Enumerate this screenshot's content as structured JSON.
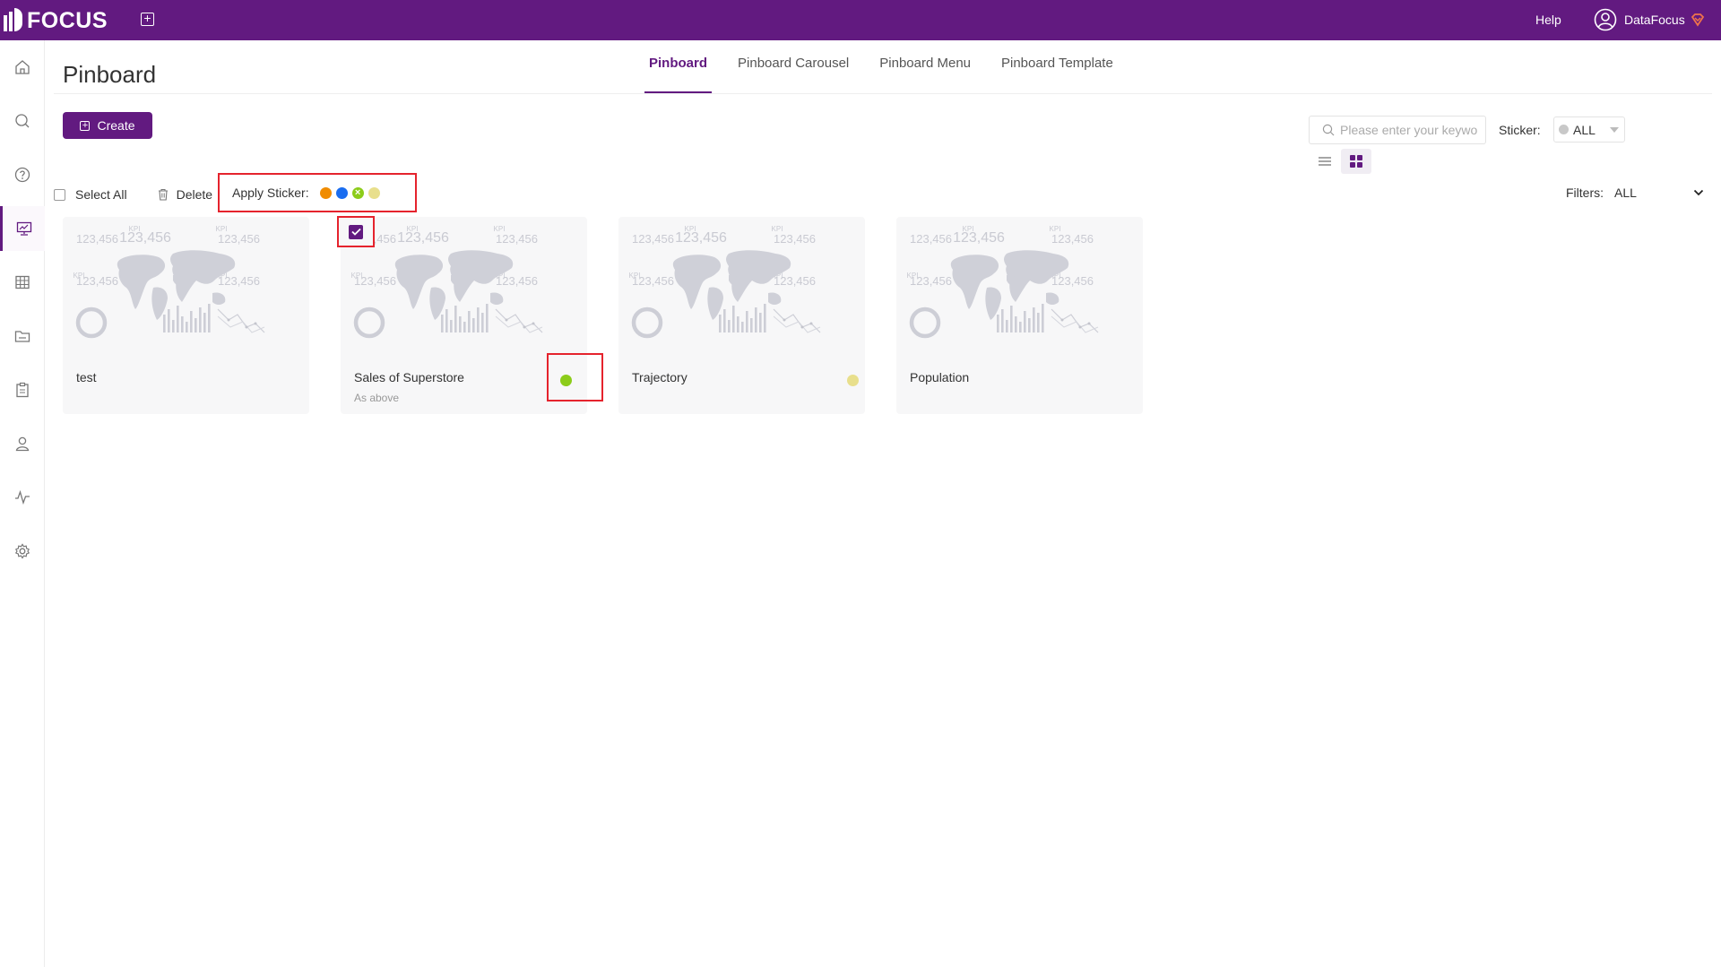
{
  "app": {
    "logo_text": "FOCUS"
  },
  "topbar": {
    "help": "Help",
    "user_name": "DataFocus"
  },
  "sidebar": {
    "items": [
      {
        "icon": "home-icon"
      },
      {
        "icon": "search-icon"
      },
      {
        "icon": "question-icon"
      },
      {
        "icon": "pinboard-icon",
        "active": true
      },
      {
        "icon": "table-icon"
      },
      {
        "icon": "folder-icon"
      },
      {
        "icon": "clipboard-icon"
      },
      {
        "icon": "user-icon"
      },
      {
        "icon": "pulse-icon"
      },
      {
        "icon": "gear-icon"
      }
    ]
  },
  "page": {
    "title": "Pinboard"
  },
  "tabs": [
    {
      "label": "Pinboard",
      "active": true
    },
    {
      "label": "Pinboard Carousel",
      "active": false
    },
    {
      "label": "Pinboard Menu",
      "active": false
    },
    {
      "label": "Pinboard Template",
      "active": false
    }
  ],
  "create_button": "Create",
  "search": {
    "placeholder": "Please enter your keywo",
    "value": ""
  },
  "sticker_filter": {
    "label": "Sticker:",
    "value": "ALL"
  },
  "toolbar": {
    "select_all": "Select All",
    "delete": "Delete",
    "apply_sticker": "Apply Sticker:",
    "sticker_colors": [
      "#f08c00",
      "#1a6df0",
      "#8ccc1a",
      "#e8df8c"
    ]
  },
  "filters": {
    "label": "Filters:",
    "value": "ALL"
  },
  "thumbnail": {
    "kpi_value": "123,456",
    "kpi_label": "KPI"
  },
  "cards": [
    {
      "name": "test",
      "subtitle": "",
      "sticker": null,
      "checked": false
    },
    {
      "name": "Sales of Superstore",
      "subtitle": "As above",
      "sticker": "#8ccc1a",
      "checked": true
    },
    {
      "name": "Trajectory",
      "subtitle": "",
      "sticker": "#e8df8c",
      "checked": false
    },
    {
      "name": "Population",
      "subtitle": "",
      "sticker": null,
      "checked": false
    }
  ],
  "colors": {
    "brand": "#621a80",
    "highlight": "#e5232d"
  }
}
